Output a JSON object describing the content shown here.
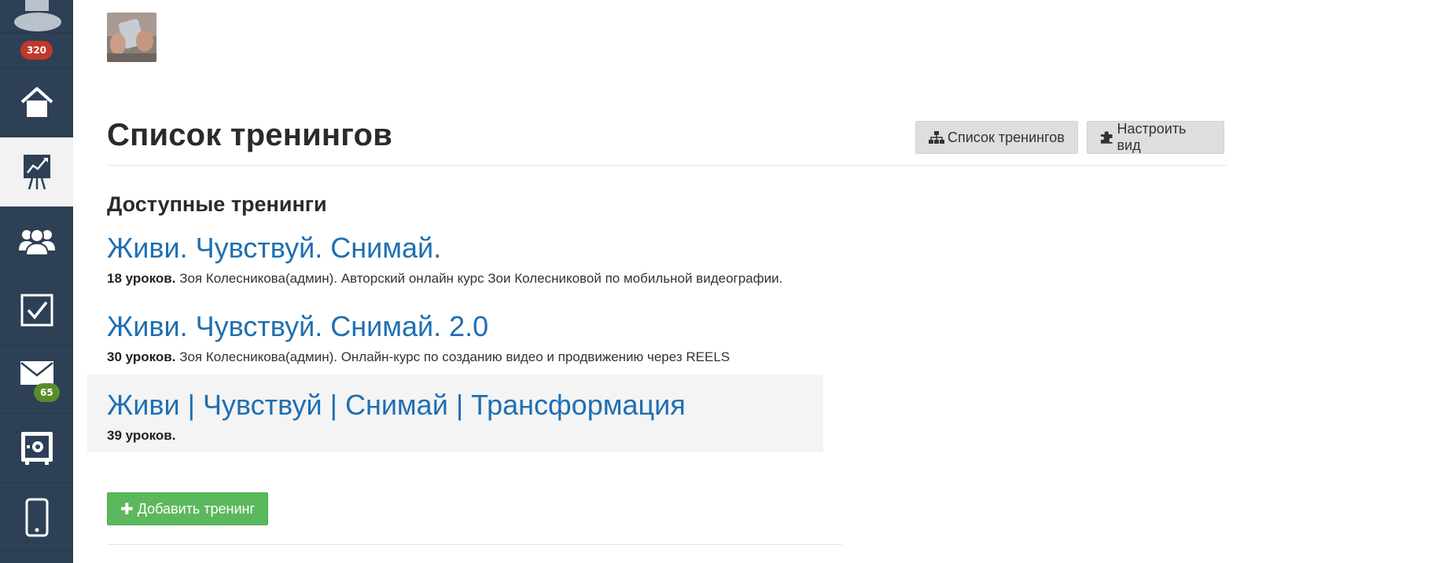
{
  "sidebar": {
    "items": [
      {
        "name": "profile-avatar"
      },
      {
        "badge": "320"
      },
      {
        "icon": "home-icon"
      },
      {
        "icon": "trainings-chart-icon",
        "active": true
      },
      {
        "icon": "users-icon"
      },
      {
        "icon": "tasks-checkbox-icon"
      },
      {
        "icon": "mail-icon",
        "badge": "65"
      },
      {
        "icon": "safe-icon"
      },
      {
        "icon": "mobile-icon"
      }
    ],
    "colors": {
      "bg": "#2e4056",
      "active_bg": "#f2f2f2",
      "badge_red": "#c0392b",
      "badge_green": "#5b8c2a"
    }
  },
  "header": {
    "title": "Список тренингов",
    "buttons": {
      "list_label": "Список тренингов",
      "view_label": "Настроить вид"
    }
  },
  "section": {
    "title": "Доступные тренинги"
  },
  "trainings": [
    {
      "title": "Живи. Чувствуй. Снимай.",
      "lessons": "18 уроков.",
      "description": " Зоя Колесникова(админ). Авторский онлайн курс Зои Колесниковой по мобильной видеографии."
    },
    {
      "title": "Живи. Чувствуй. Снимай. 2.0",
      "lessons": "30 уроков.",
      "description": " Зоя Колесникова(админ). Онлайн-курс по созданию видео и продвижению через REELS"
    },
    {
      "title": "Живи | Чувствуй | Снимай | Трансформация",
      "lessons": "39 уроков.",
      "description": ""
    }
  ],
  "actions": {
    "add_label": "Добавить тренинг"
  },
  "colors": {
    "link": "#1f6fb2",
    "add_button": "#5cb85c"
  }
}
